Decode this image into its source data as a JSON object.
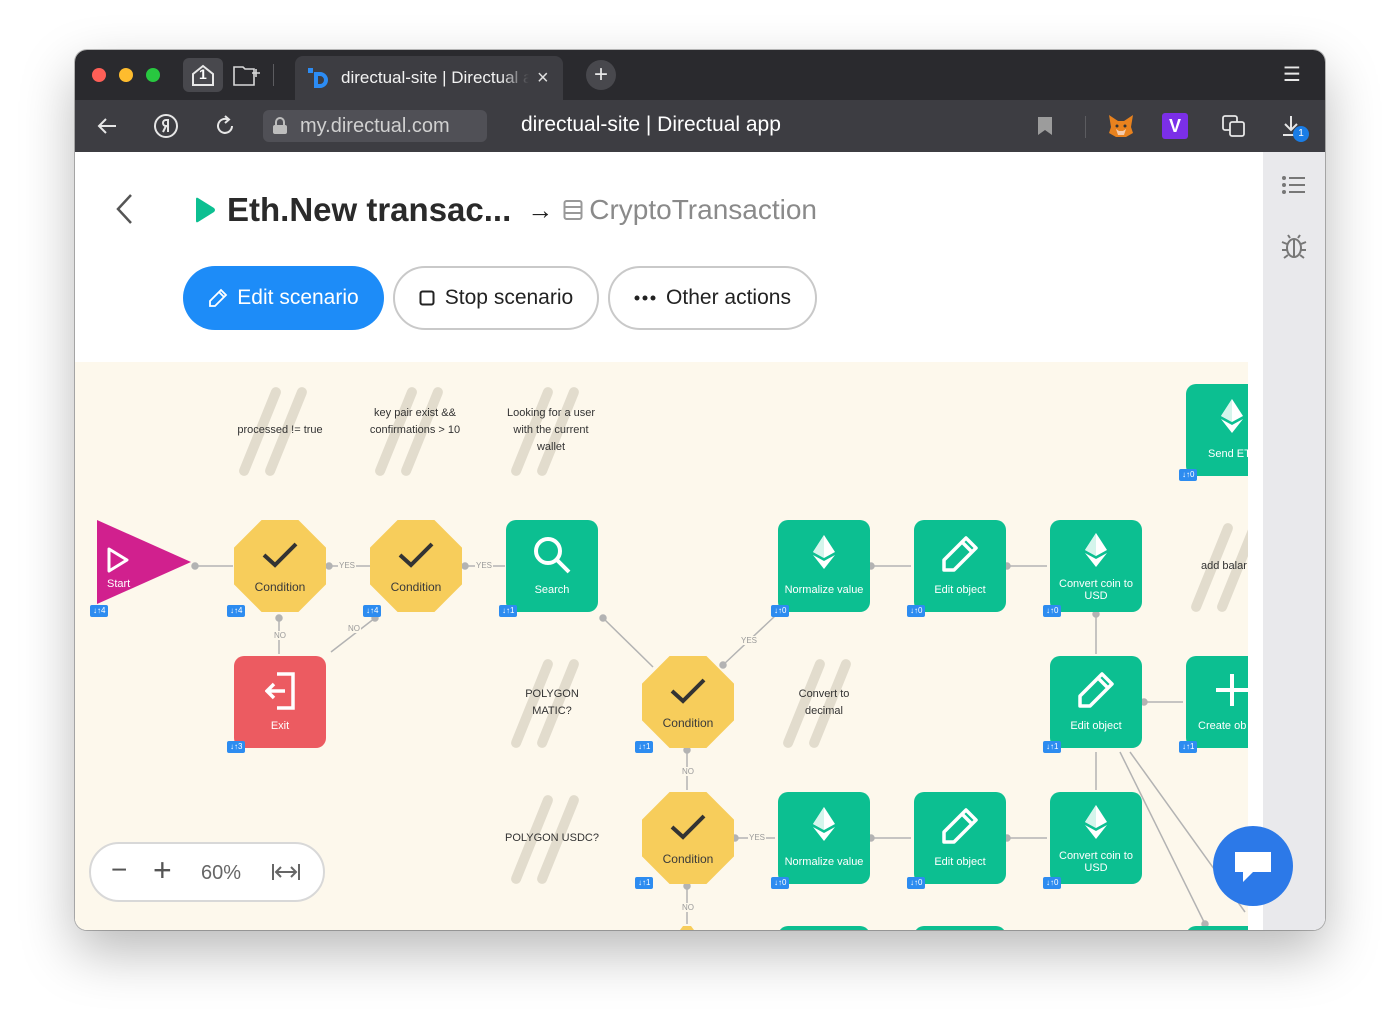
{
  "browser": {
    "home_tab_count": "1",
    "tab": {
      "title": "directual-site | Directual app",
      "close": "×",
      "new_tab": "+"
    },
    "menu": "☰",
    "address": {
      "url": "my.directual.com",
      "page_title": "directual-site | Directual app",
      "download_badge": "1"
    }
  },
  "header": {
    "scenario_title": "Eth.New transac...",
    "arrow": "→",
    "target_table": "CryptoTransaction",
    "buttons": {
      "edit": "Edit scenario",
      "stop": "Stop scenario",
      "other": "Other actions"
    }
  },
  "canvas": {
    "notes": {
      "processed": "processed != true",
      "keypair": "key pair exist && confirmations > 10",
      "lookup": "Looking for a user with the current wallet",
      "polygon_matic": "POLYGON MATIC?",
      "convert_decimal": "Convert to decimal",
      "polygon_usdc": "POLYGON USDC?",
      "add_balance": "add balar"
    },
    "nodes": {
      "start": "Start",
      "cond1": "Condition",
      "cond2": "Condition",
      "search": "Search",
      "exit": "Exit",
      "cond3": "Condition",
      "cond4": "Condition",
      "normalize1": "Normalize value",
      "edit1": "Edit object",
      "convert1": "Convert coin to USD",
      "send": "Send ET",
      "edit_mid": "Edit object",
      "create": "Create ob",
      "normalize2": "Normalize value",
      "edit2": "Edit object",
      "convert2": "Convert coin to USD"
    },
    "badges": {
      "start": "↓↑4",
      "cond1": "↓↑4",
      "cond2": "↓↑4",
      "search": "↓↑1",
      "exit": "↓↑3",
      "cond3": "↓↑1",
      "cond4": "↓↑1",
      "normalize1": "↓↑0",
      "edit1": "↓↑0",
      "convert1": "↓↑0",
      "send": "↓↑0",
      "edit_mid": "↓↑1",
      "create": "↓↑1",
      "normalize2": "↓↑0",
      "edit2": "↓↑0",
      "convert2": "↓↑0"
    },
    "link_labels": {
      "yes": "YES",
      "no": "NO"
    },
    "zoom": {
      "minus": "−",
      "plus": "+",
      "level": "60%"
    }
  },
  "colors": {
    "accent": "#1d8cf8",
    "teal": "#0cbf91",
    "condition": "#f7cd5b",
    "start": "#d1208e",
    "exit": "#ec5b61",
    "canvas_bg": "#fdf8ec"
  }
}
